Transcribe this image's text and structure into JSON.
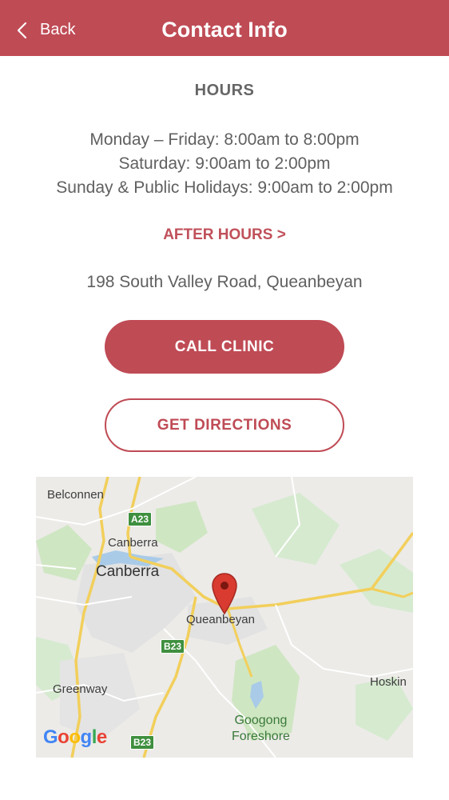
{
  "header": {
    "back_label": "Back",
    "title": "Contact Info"
  },
  "hours": {
    "title": "HOURS",
    "lines": [
      "Monday – Friday: 8:00am to 8:00pm",
      "Saturday: 9:00am to 2:00pm",
      "Sunday & Public Holidays: 9:00am to 2:00pm"
    ]
  },
  "after_hours_link": "AFTER HOURS >",
  "address": "198 South Valley Road, Queanbeyan",
  "buttons": {
    "call": "CALL CLINIC",
    "directions": "GET DIRECTIONS"
  },
  "map": {
    "labels": {
      "belconnen": "Belconnen",
      "canberra_small": "Canberra",
      "canberra": "Canberra",
      "queanbeyan": "Queanbeyan",
      "greenway": "Greenway",
      "hoskin": "Hoskin",
      "googong": "Googong\nForeshore"
    },
    "road_badges": {
      "a23": "A23",
      "b23_mid": "B23",
      "b23_bottom": "B23"
    },
    "logo": [
      "G",
      "o",
      "o",
      "g",
      "l",
      "e"
    ],
    "logo_colors": [
      "#4285F4",
      "#EA4335",
      "#FBBC05",
      "#4285F4",
      "#34A853",
      "#EA4335"
    ],
    "pin_color": "#d93b30"
  },
  "colors": {
    "accent": "#bf4b55",
    "text": "#606060"
  }
}
